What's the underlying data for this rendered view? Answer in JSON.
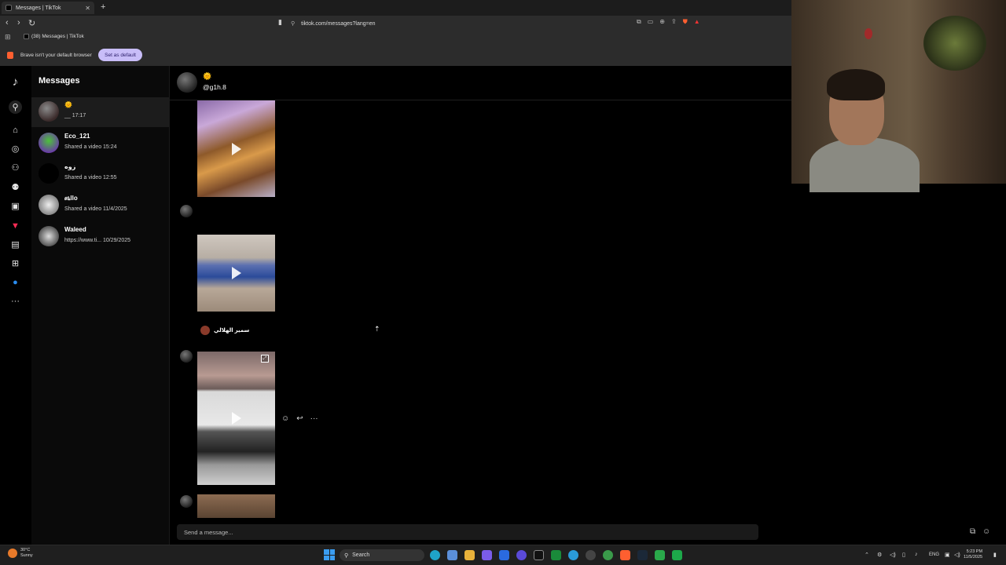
{
  "browser": {
    "tab_title": "Messages | TikTok",
    "new_tab_icon": "plus-icon",
    "url": "tiktok.com/messages?lang=en",
    "bookmark_label": "(38) Messages | TikTok",
    "infobar_text": "Brave isn't your default browser",
    "set_default_label": "Set as default"
  },
  "sidebar": {
    "icons": [
      "tiktok-logo-icon",
      "search-icon",
      "home-icon",
      "explore-icon",
      "following-icon",
      "friends-icon",
      "live-icon",
      "activity-icon",
      "messages-icon",
      "upload-icon",
      "profile-icon",
      "more-icon"
    ]
  },
  "messages": {
    "title": "Messages",
    "conversations": [
      {
        "name": "🌞",
        "sub": "__ 17:17"
      },
      {
        "name": "Eco_121",
        "sub": "Shared a video 15:24"
      },
      {
        "name": "زوه",
        "sub": "Shared a video 12:55"
      },
      {
        "name": "ፀኒllo",
        "sub": "Shared a video 11/4/2025"
      },
      {
        "name": "Waleed",
        "sub": "https://www.ti... 10/29/2025"
      }
    ]
  },
  "chat": {
    "emoji": "🌞",
    "handle": "@g1h.8",
    "author_name": "سمير الهلالي",
    "composer_placeholder": "Send a message..."
  },
  "taskbar": {
    "weather_temp": "30°C",
    "weather_cond": "Sunny",
    "search_label": "Search",
    "lang": "ENG",
    "time": "5:23 PM",
    "date": "11/5/2025"
  },
  "colors": {
    "set_default_bg": "#c8bdf8",
    "brave_orange": "#ff5f30",
    "app_bg": "#000000"
  }
}
